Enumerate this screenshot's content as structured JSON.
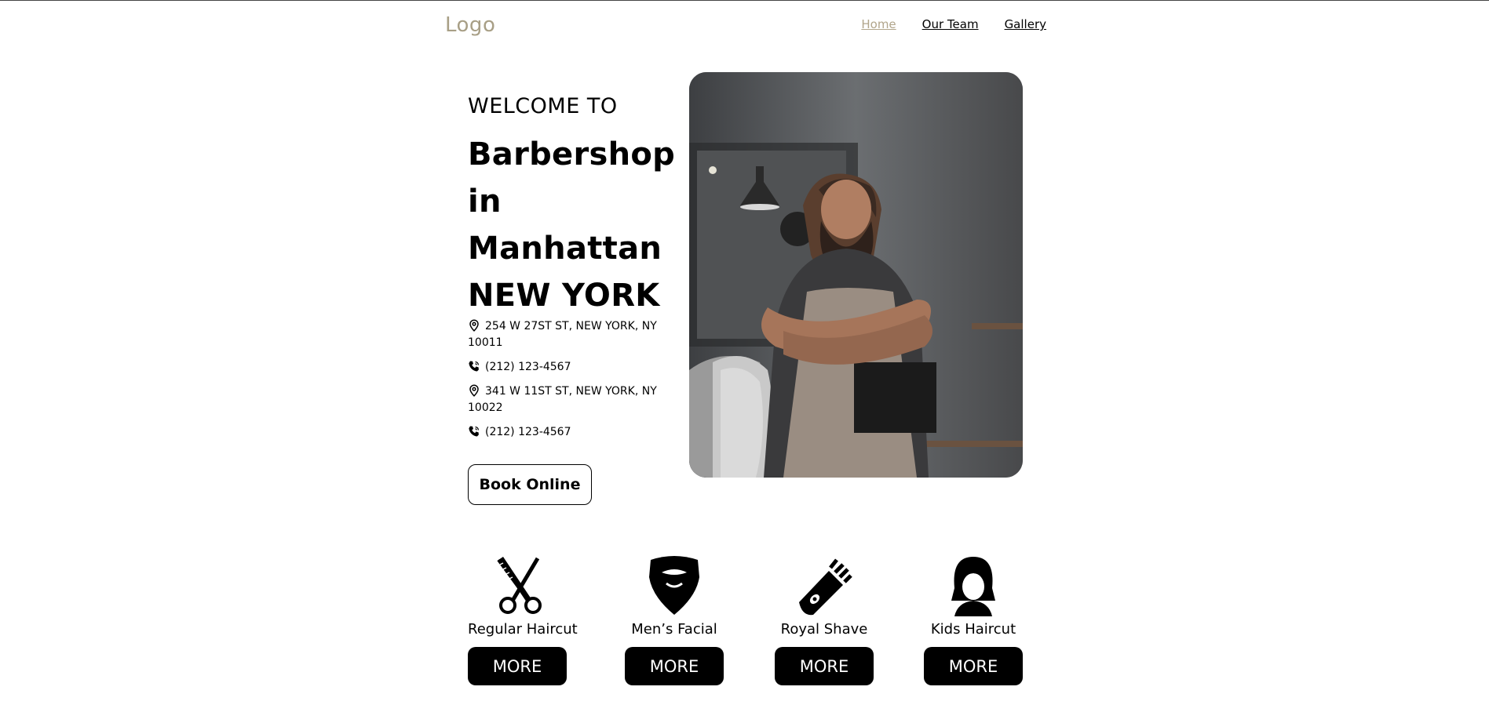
{
  "header": {
    "logo": "Logo",
    "nav": [
      {
        "label": "Home",
        "active": true
      },
      {
        "label": "Our Team",
        "active": false
      },
      {
        "label": "Gallery",
        "active": false
      }
    ]
  },
  "hero": {
    "welcome": "WELCOME TO",
    "headline_lines": [
      "Barbershop",
      "in",
      "Manhattan",
      "NEW YORK"
    ],
    "contacts": [
      {
        "icon": "location-pin-icon",
        "text": "254 W 27ST ST, NEW YORK, NY 10011"
      },
      {
        "icon": "phone-icon",
        "text": "(212) 123-4567"
      },
      {
        "icon": "location-pin-icon",
        "text": "341 W 11ST ST, NEW YORK, NY 10022"
      },
      {
        "icon": "phone-icon",
        "text": "(212) 123-4567"
      }
    ],
    "book_label": "Book Online"
  },
  "services": [
    {
      "icon": "scissors-icon",
      "label": "Regular Haircut",
      "button": "MORE"
    },
    {
      "icon": "beard-icon",
      "label": "Men’s Facial",
      "button": "MORE"
    },
    {
      "icon": "clipper-icon",
      "label": "Royal Shave",
      "button": "MORE"
    },
    {
      "icon": "woman-head-icon",
      "label": "Kids Haircut",
      "button": "MORE"
    }
  ],
  "colors": {
    "accent": "#b1a58b",
    "logo": "#a89f86",
    "button_dark": "#000000"
  }
}
